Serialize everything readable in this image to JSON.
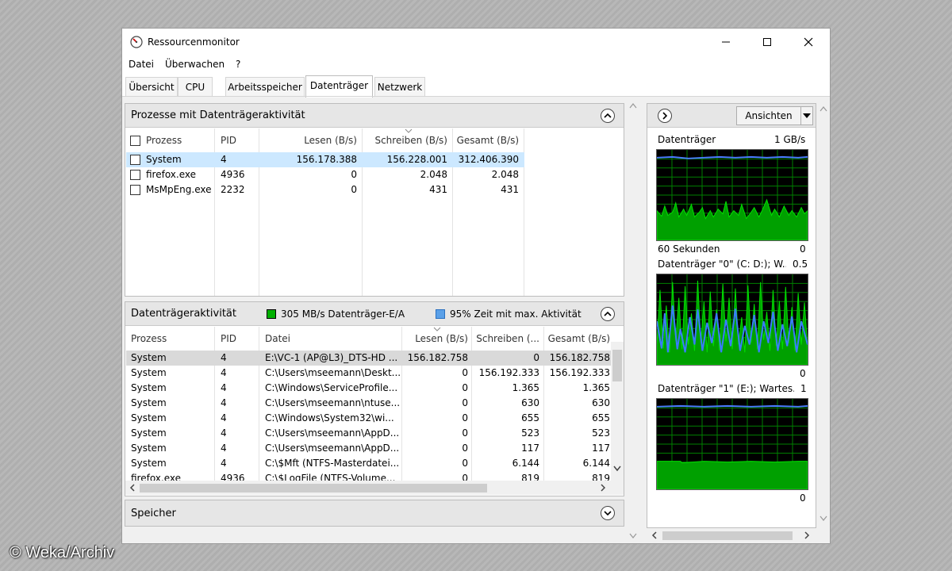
{
  "window": {
    "title": "Ressourcenmonitor"
  },
  "menu": [
    "Datei",
    "Überwachen",
    "?"
  ],
  "tabs": [
    "Übersicht",
    "CPU",
    "Arbeitsspeicher",
    "Datenträger",
    "Netzwerk"
  ],
  "active_tab": "Datenträger",
  "processes_panel": {
    "title": "Prozesse mit Datenträgeraktivität",
    "columns": [
      "Prozess",
      "PID",
      "Lesen (B/s)",
      "Schreiben (B/s)",
      "Gesamt (B/s)"
    ],
    "rows": [
      [
        "System",
        "4",
        "156.178.388",
        "156.228.001",
        "312.406.390"
      ],
      [
        "firefox.exe",
        "4936",
        "0",
        "2.048",
        "2.048"
      ],
      [
        "MsMpEng.exe",
        "2232",
        "0",
        "431",
        "431"
      ]
    ]
  },
  "disk_activity_panel": {
    "title": "Datenträgeraktivität",
    "io_label": "305 MB/s Datenträger-E/A",
    "io_color": "#00b000",
    "time_label": "95% Zeit mit max. Aktivität",
    "time_color": "#5aa0e8",
    "columns": [
      "Prozess",
      "PID",
      "Datei",
      "Lesen (B/s)",
      "Schreiben (...",
      "Gesamt (B/s)"
    ],
    "rows": [
      [
        "System",
        "4",
        "E:\\VC-1 (AP@L3)_DTS-HD ...",
        "156.182.758",
        "0",
        "156.182.758"
      ],
      [
        "System",
        "4",
        "C:\\Users\\mseemann\\Deskt...",
        "0",
        "156.192.333",
        "156.192.333"
      ],
      [
        "System",
        "4",
        "C:\\Windows\\ServiceProfile...",
        "0",
        "1.365",
        "1.365"
      ],
      [
        "System",
        "4",
        "C:\\Users\\mseemann\\ntuse...",
        "0",
        "630",
        "630"
      ],
      [
        "System",
        "4",
        "C:\\Windows\\System32\\wi...",
        "0",
        "655",
        "655"
      ],
      [
        "System",
        "4",
        "C:\\Users\\mseemann\\AppD...",
        "0",
        "523",
        "523"
      ],
      [
        "System",
        "4",
        "C:\\Users\\mseemann\\AppD...",
        "0",
        "117",
        "117"
      ],
      [
        "System",
        "4",
        "C:\\$Mft (NTFS-Masterdatei...",
        "0",
        "6.144",
        "6.144"
      ],
      [
        "firefox.exe",
        "4936",
        "C:\\$LogFile (NTFS-Volume...",
        "0",
        "819",
        "819"
      ]
    ]
  },
  "memory_panel": {
    "title": "Speicher"
  },
  "side": {
    "views_button": "Ansichten",
    "graphs": [
      {
        "label": "Datenträger",
        "max": "1 GB/s",
        "bottom_left": "60 Sekunden",
        "bottom_right": "0"
      },
      {
        "label": "Datenträger \"0\" (C: D:); W...",
        "max": "0.5",
        "bottom_left": "",
        "bottom_right": "0"
      },
      {
        "label": "Datenträger \"1\" (E:); Wartes...",
        "max": "1",
        "bottom_left": "",
        "bottom_right": "0"
      }
    ]
  },
  "watermark": "© Weka/Archiv"
}
